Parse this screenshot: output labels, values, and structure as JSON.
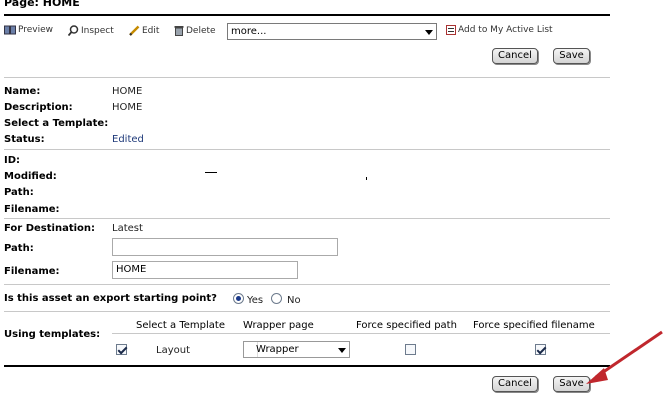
{
  "page": {
    "title": "Page: HOME"
  },
  "toolbar": {
    "preview": "Preview",
    "inspect": "Inspect",
    "edit": "Edit",
    "delete": "Delete",
    "more_select": "more...",
    "add_active": "Add to My Active List"
  },
  "buttons": {
    "cancel": "Cancel",
    "save": "Save"
  },
  "info": {
    "name_label": "Name:",
    "name_value": "HOME",
    "description_label": "Description:",
    "description_value": "HOME",
    "template_label": "Select a Template:",
    "status_label": "Status:",
    "status_value": "Edited"
  },
  "meta": {
    "id_label": "ID:",
    "modified_label": "Modified:",
    "path_label": "Path:",
    "filename_label": "Filename:"
  },
  "destination": {
    "label": "For Destination:",
    "value": "Latest",
    "path_label": "Path:",
    "path_value": "",
    "filename_label": "Filename:",
    "filename_value": "HOME"
  },
  "export": {
    "question": "Is this asset an export starting point?",
    "yes": "Yes",
    "no": "No",
    "selected": "Yes"
  },
  "templates": {
    "label": "Using templates:",
    "headers": [
      "Select a Template",
      "Wrapper page",
      "Force specified path",
      "Force specified filename"
    ],
    "row": {
      "checked": true,
      "template": "Layout",
      "wrapper": "Wrapper",
      "force_path": false,
      "force_filename": true
    }
  },
  "colors": {
    "annotation_arrow": "#c0272d",
    "status_text": "#1f3a7a"
  }
}
